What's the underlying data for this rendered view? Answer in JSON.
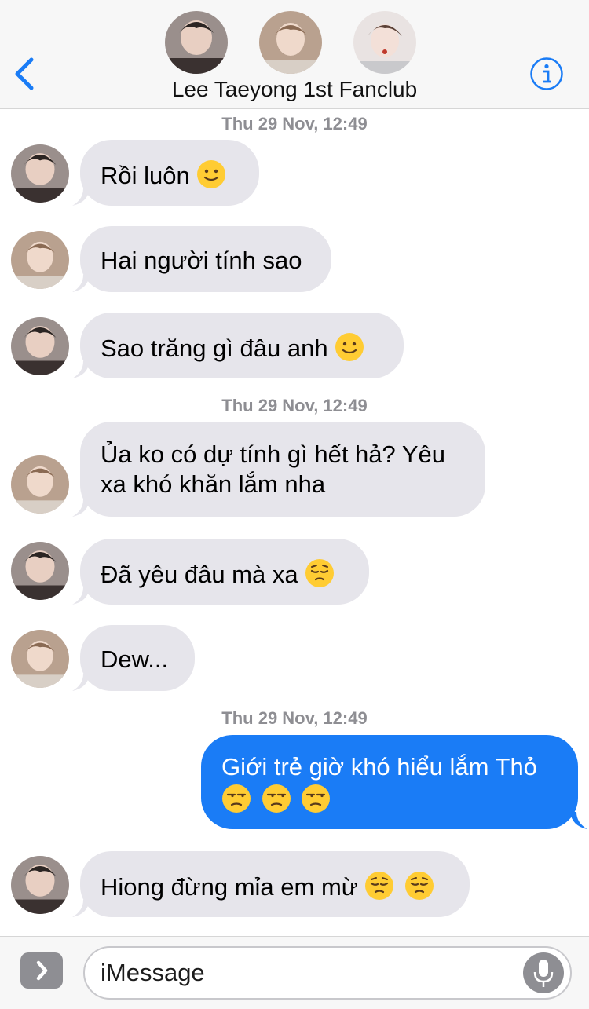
{
  "header": {
    "title": "Lee Taeyong 1st Fanclub",
    "back_icon": "chevron-left-icon",
    "info_icon": "info-icon",
    "accent": "#1a7cf6"
  },
  "conversation": [
    {
      "type": "timestamp",
      "text": "Thu 29 Nov, 12:49"
    },
    {
      "type": "incoming",
      "sender_avatar": "avatar-1",
      "lines": [
        "Rồi luôn"
      ],
      "emojis": [
        "slight-smile"
      ]
    },
    {
      "type": "incoming",
      "sender_avatar": "avatar-2",
      "lines": [
        "Hai người tính sao"
      ],
      "emojis": []
    },
    {
      "type": "incoming",
      "sender_avatar": "avatar-1",
      "lines": [
        "Sao trăng gì đâu anh"
      ],
      "emojis": [
        "slight-smile"
      ]
    },
    {
      "type": "timestamp",
      "text": "Thu 29 Nov, 12:49"
    },
    {
      "type": "incoming",
      "sender_avatar": "avatar-2",
      "lines": [
        "Ủa ko có dự tính gì hết hả? Yêu",
        "xa khó khăn lắm nha"
      ],
      "emojis": []
    },
    {
      "type": "incoming",
      "sender_avatar": "avatar-1",
      "lines": [
        "Đã yêu đâu mà xa"
      ],
      "emojis": [
        "pensive"
      ]
    },
    {
      "type": "incoming",
      "sender_avatar": "avatar-2",
      "lines": [
        "Dew..."
      ],
      "emojis": []
    },
    {
      "type": "timestamp",
      "text": "Thu 29 Nov, 12:49"
    },
    {
      "type": "outgoing",
      "lines": [
        "Giới trẻ giờ khó hiểu lắm Thỏ"
      ],
      "emojis": [
        "unamused",
        "unamused",
        "unamused"
      ]
    },
    {
      "type": "incoming",
      "sender_avatar": "avatar-1",
      "lines": [
        "Hiong đừng mỉa em mừ"
      ],
      "emojis": [
        "pensive",
        "pensive"
      ]
    }
  ],
  "input": {
    "placeholder": "iMessage",
    "expand_icon": "chevron-right-icon",
    "mic_icon": "microphone-icon"
  },
  "colors": {
    "incoming_bubble": "#e6e5eb",
    "outgoing_bubble": "#1a7cf6",
    "timestamp": "#8e8e93"
  }
}
